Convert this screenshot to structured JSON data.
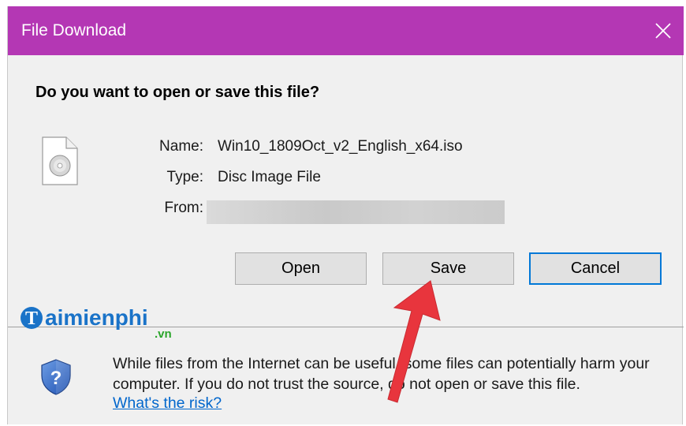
{
  "dialog": {
    "title": "File Download",
    "question": "Do you want to open or save this file?"
  },
  "file_info": {
    "name_label": "Name:",
    "name_value": "Win10_1809Oct_v2_English_x64.iso",
    "type_label": "Type:",
    "type_value": "Disc Image File",
    "from_label": "From:",
    "from_value": ""
  },
  "buttons": {
    "open": "Open",
    "save": "Save",
    "cancel": "Cancel"
  },
  "warning": {
    "text": "While files from the Internet can be useful, some files can potentially harm your computer. If you do not trust the source, do not open or save this file.",
    "link": "What's the risk?"
  },
  "watermark": {
    "brand": "aimienphi",
    "suffix": ".vn"
  },
  "icons": {
    "file": "disc-file-icon",
    "shield": "security-shield-icon",
    "close": "close-icon",
    "pointer": "red-arrow-icon"
  },
  "colors": {
    "titlebar": "#b437b4",
    "link": "#0066cc",
    "default_button_border": "#0078d7",
    "arrow": "#e8353d"
  }
}
